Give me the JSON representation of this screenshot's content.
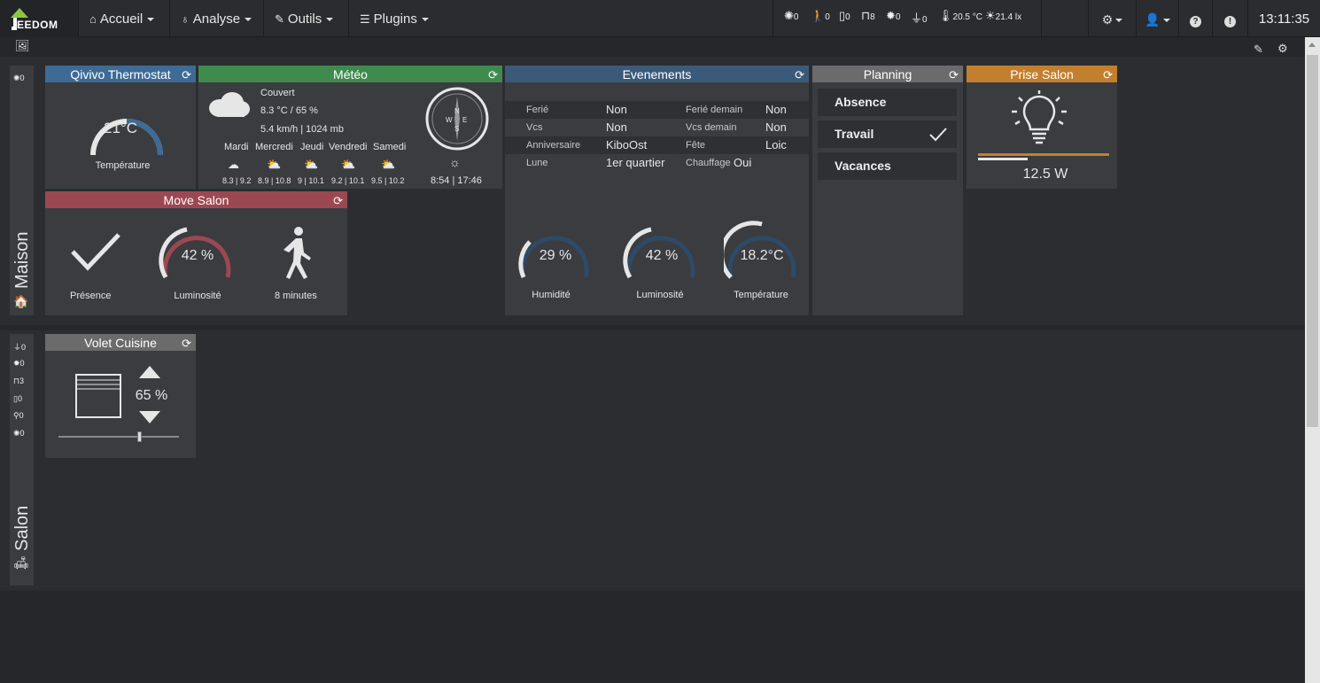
{
  "navbar": {
    "logo_text": "EEDOM",
    "menus": [
      {
        "label": "Accueil",
        "icon": "home-icon"
      },
      {
        "label": "Analyse",
        "icon": "analyse-icon"
      },
      {
        "label": "Outils",
        "icon": "wrench-icon"
      },
      {
        "label": "Plugins",
        "icon": "plugins-icon"
      }
    ],
    "summary": {
      "light": "0",
      "motion": "0",
      "door": "0",
      "shutter": "8",
      "lamp": "0",
      "plug": "0",
      "temperature": "20.5 °C",
      "luminosity": "21.4 lx"
    },
    "clock": "13:11:35"
  },
  "objects": [
    {
      "name": "Maison",
      "summary": [
        {
          "icon": "light-icon",
          "value": "0"
        }
      ],
      "widgets": {
        "thermostat": {
          "title": "Qivivo Thermostat",
          "value": "21°C",
          "label": "Température",
          "gauge_fraction": 0.55,
          "color": "#3d6b96"
        },
        "meteo": {
          "title": "Météo",
          "condition": "Couvert",
          "temp_hum": "8.3 °C / 65 %",
          "wind_pressure": "5.4 km/h | 1024 mb",
          "compass": {
            "n": "N",
            "e": "E",
            "s": "S",
            "w": "W"
          },
          "sun_times": "8:54 | 17:46",
          "color": "#3f8b4e",
          "forecast": [
            {
              "day": "Mardi",
              "range": "8.3 | 9.2"
            },
            {
              "day": "Mercredi",
              "range": "8.9 | 10.8"
            },
            {
              "day": "Jeudi",
              "range": "9 | 10.1"
            },
            {
              "day": "Vendredi",
              "range": "9.2 | 10.1"
            },
            {
              "day": "Samedi",
              "range": "9.5 | 10.2"
            }
          ]
        },
        "evenements": {
          "title": "Evenements",
          "color": "#3b5a7a",
          "rows": [
            {
              "k1": "Ferié",
              "v1": "Non",
              "k2": "Ferié demain",
              "v2": "Non"
            },
            {
              "k1": "Vcs",
              "v1": "Non",
              "k2": "Vcs demain",
              "v2": "Non"
            },
            {
              "k1": "Anniversaire",
              "v1": "KiboOst",
              "k2": "Fête",
              "v2": "Loic"
            },
            {
              "k1": "Lune",
              "v1": "1er quartier",
              "k2": "Chauffage",
              "v2": "Oui"
            }
          ],
          "gauges": [
            {
              "value": "29 %",
              "label": "Humidité",
              "fraction": 0.29
            },
            {
              "value": "42 %",
              "label": "Luminosité",
              "fraction": 0.42
            },
            {
              "value": "18.2°C",
              "label": "Température",
              "fraction": 0.5
            }
          ]
        },
        "planning": {
          "title": "Planning",
          "color": "#6b6b6b",
          "options": [
            {
              "label": "Absence",
              "checked": false
            },
            {
              "label": "Travail",
              "checked": true
            },
            {
              "label": "Vacances",
              "checked": false
            }
          ]
        },
        "prise": {
          "title": "Prise Salon",
          "color": "#c27f2e",
          "value": "12.5 W",
          "bar_fraction": 0.38
        },
        "move": {
          "title": "Move Salon",
          "color": "#9c4852",
          "presence_label": "Présence",
          "lum_value": "42 %",
          "lum_label": "Luminosité",
          "lum_fraction": 0.42,
          "time_label": "8 minutes"
        }
      }
    },
    {
      "name": "Salon",
      "summary": [
        {
          "icon": "plug-icon",
          "value": "0"
        },
        {
          "icon": "lamp-icon",
          "value": "0"
        },
        {
          "icon": "shutter-icon",
          "value": "3"
        },
        {
          "icon": "door-icon",
          "value": "0"
        },
        {
          "icon": "motion-icon",
          "value": "0"
        },
        {
          "icon": "light-icon",
          "value": "0"
        }
      ],
      "widgets": {
        "volet": {
          "title": "Volet Cuisine",
          "color": "#6b6b6b",
          "value": "65 %",
          "slider_fraction": 0.68
        }
      }
    }
  ]
}
